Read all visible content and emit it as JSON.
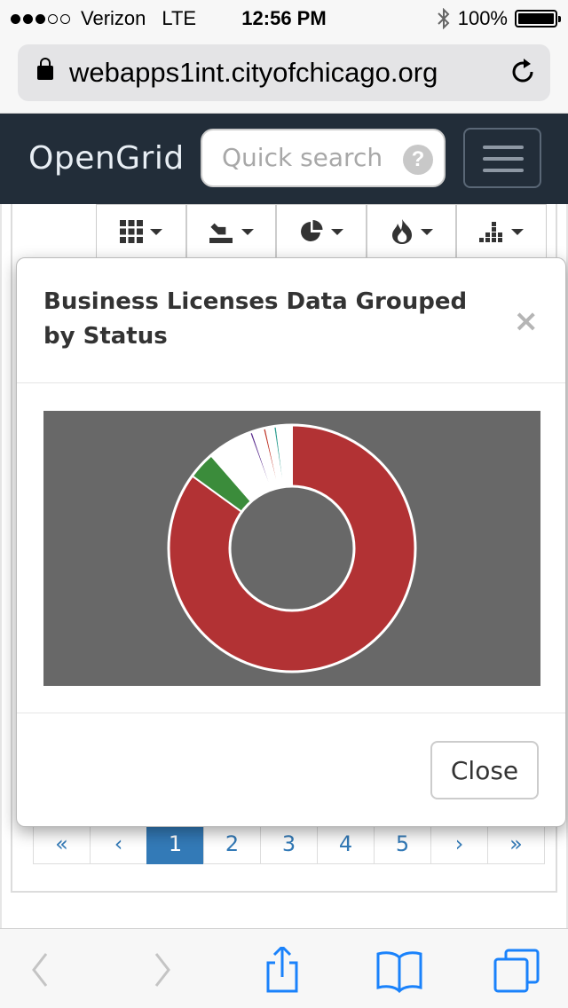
{
  "status_bar": {
    "carrier": "Verizon",
    "network": "LTE",
    "time": "12:56 PM",
    "battery": "100%",
    "battery_level": 1.0,
    "signal_bars_filled": 3,
    "signal_bars_total": 5
  },
  "browser": {
    "url": "webapps1int.cityofchicago.org"
  },
  "navbar": {
    "brand": "OpenGrid",
    "search_placeholder": "Quick search",
    "help_label": "?"
  },
  "toolbar": {
    "buttons": [
      {
        "icon": "grid-icon"
      },
      {
        "icon": "map-marker-icon"
      },
      {
        "icon": "pie-chart-icon"
      },
      {
        "icon": "fire-icon"
      },
      {
        "icon": "bar-chart-icon"
      }
    ]
  },
  "modal": {
    "title": "Business Licenses Data Grouped by Status",
    "close_x": "×",
    "close_button": "Close"
  },
  "pagination": {
    "first": "«",
    "prev": "‹",
    "pages": [
      "1",
      "2",
      "3",
      "4",
      "5"
    ],
    "active_page": "1",
    "next": "›",
    "last": "»"
  },
  "colors": {
    "navbar_bg": "#222d39",
    "chart_bg": "#686868",
    "pager_active": "#337ab7",
    "ios_blue": "#1a82fb"
  },
  "chart_data": {
    "type": "pie",
    "variant": "donut",
    "title": "",
    "series": [
      {
        "value": 85.0,
        "color": "#b23234"
      },
      {
        "value": 3.6,
        "color": "#3b8c3b"
      },
      {
        "value": 3.4,
        "color": "#ffffff"
      },
      {
        "value": 2.4,
        "color": "#ffffff"
      },
      {
        "value": 0.4,
        "color": "#5b2d8e"
      },
      {
        "value": 1.4,
        "color": "#ffffff"
      },
      {
        "value": 0.4,
        "color": "#c0392b"
      },
      {
        "value": 1.0,
        "color": "#ffffff"
      },
      {
        "value": 0.4,
        "color": "#2a9d8f"
      },
      {
        "value": 2.0,
        "color": "#ffffff"
      }
    ]
  }
}
